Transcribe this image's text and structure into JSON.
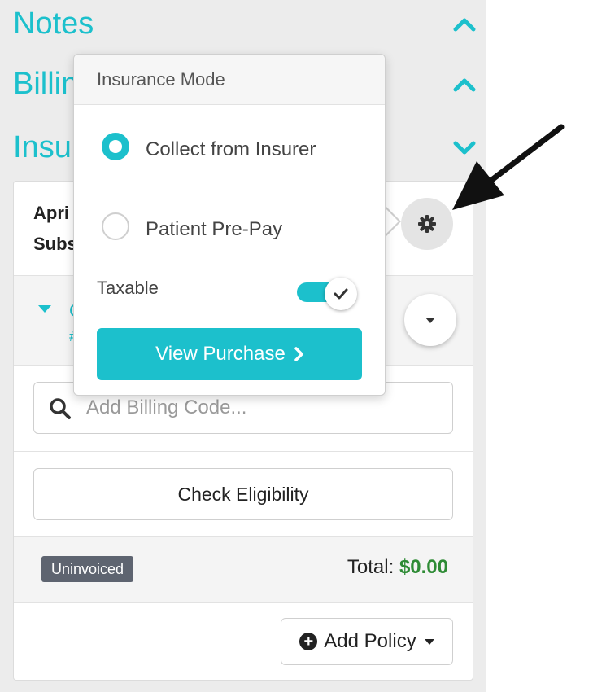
{
  "sections": [
    {
      "title": "Notes",
      "chevron": "chevron-up-icon"
    },
    {
      "title": "Billing",
      "chevron": "chevron-up-icon"
    },
    {
      "title": "Insurance",
      "chevron": "chevron-down-icon"
    }
  ],
  "policy": {
    "name_partial": "Apri",
    "subscriber_partial": "Subs",
    "item_partial": "C",
    "item_hash_partial": "#"
  },
  "search": {
    "placeholder": "Add Billing Code..."
  },
  "eligibility": {
    "label": "Check Eligibility"
  },
  "status": {
    "badge": "Uninvoiced",
    "total_label": "Total:",
    "total_amount": "$0.00"
  },
  "add_policy": {
    "label": "Add Policy"
  },
  "popover": {
    "title": "Insurance Mode",
    "options": [
      {
        "label": "Collect from Insurer",
        "selected": true
      },
      {
        "label": "Patient Pre-Pay",
        "selected": false
      }
    ],
    "taxable_label": "Taxable",
    "taxable_on": true,
    "view_button": "View Purchase"
  },
  "colors": {
    "accent": "#1cc0cc",
    "total": "#2e8b35",
    "badge": "#5e6470"
  }
}
